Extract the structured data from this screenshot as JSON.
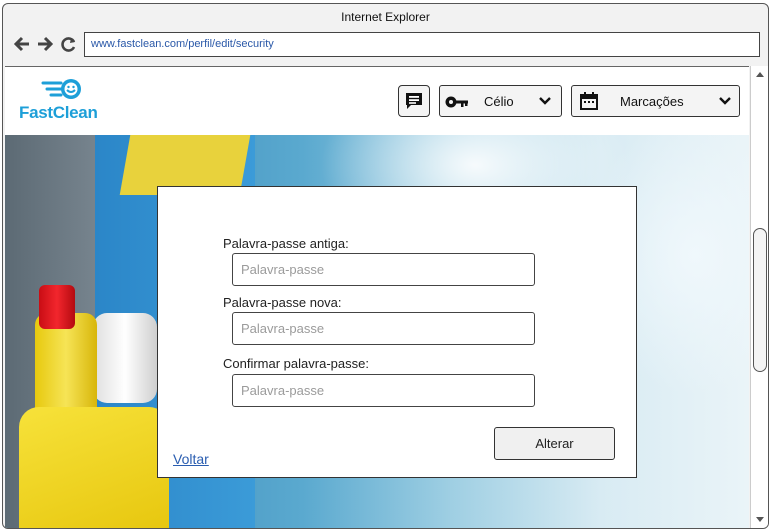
{
  "browser": {
    "title": "Internet Explorer",
    "url": "www.fastclean.com/perfil/edit/security"
  },
  "header": {
    "logo_text": "FastClean",
    "user_menu": {
      "label": "Célio",
      "icon": "key-icon"
    },
    "appointments_menu": {
      "label": "Marcações",
      "icon": "calendar-icon"
    },
    "chat_icon": "chat-icon"
  },
  "form": {
    "old_password": {
      "label": "Palavra-passe antiga:",
      "placeholder": "Palavra-passe"
    },
    "new_password": {
      "label": "Palavra-passe nova:",
      "placeholder": "Palavra-passe"
    },
    "confirm_password": {
      "label": "Confirmar palavra-passe:",
      "placeholder": "Palavra-passe"
    },
    "submit_label": "Alterar",
    "back_label": "Voltar"
  },
  "colors": {
    "brand": "#1d9fd8",
    "link": "#2a5db0"
  }
}
